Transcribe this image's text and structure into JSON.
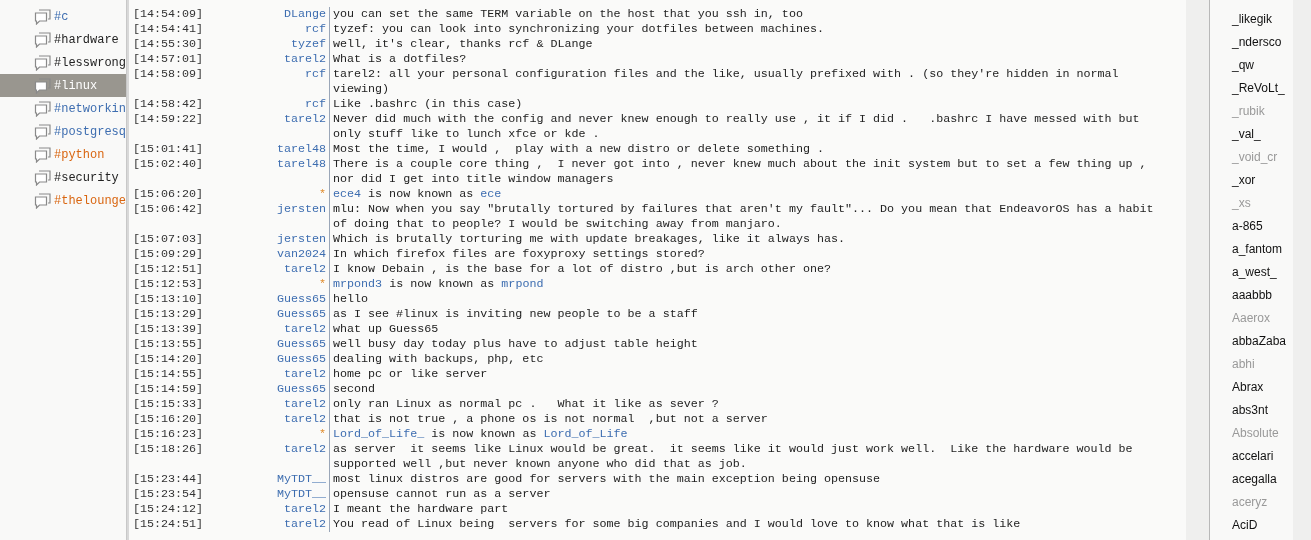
{
  "channels": [
    {
      "name": "#c",
      "color": "#3d6db0",
      "selected": false
    },
    {
      "name": "#hardware",
      "color": "#222222",
      "selected": false
    },
    {
      "name": "#lesswrong",
      "color": "#222222",
      "selected": false
    },
    {
      "name": "#linux",
      "selected": true
    },
    {
      "name": "#networkin",
      "color": "#3d6db0",
      "selected": false
    },
    {
      "name": "#postgresq",
      "color": "#3d6db0",
      "selected": false
    },
    {
      "name": "#python",
      "color": "#d9650f",
      "selected": false
    },
    {
      "name": "#security",
      "color": "#222222",
      "selected": false
    },
    {
      "name": "#thelounge",
      "color": "#d9650f",
      "selected": false
    }
  ],
  "messages": [
    {
      "kind": "message",
      "time": "[14:54:09]",
      "nick": "DLange",
      "text": "you can set the same TERM variable on the host that you ssh in, too"
    },
    {
      "kind": "message",
      "time": "[14:54:41]",
      "nick": "rcf",
      "text": "tyzef: you can look into synchronizing your dotfiles between machines."
    },
    {
      "kind": "message",
      "time": "[14:55:30]",
      "nick": "tyzef",
      "text": "well, it's clear, thanks rcf & DLange"
    },
    {
      "kind": "message",
      "time": "[14:57:01]",
      "nick": "tarel2",
      "text": "What is a dotfiles?"
    },
    {
      "kind": "message",
      "time": "[14:58:09]",
      "nick": "rcf",
      "text": "tarel2: all your personal configuration files and the like, usually prefixed with . (so they're hidden in normal viewing)"
    },
    {
      "kind": "message",
      "time": "[14:58:42]",
      "nick": "rcf",
      "text": "Like .bashrc (in this case)"
    },
    {
      "kind": "message",
      "time": "[14:59:22]",
      "nick": "tarel2",
      "text": "Never did much with the config and never knew enough to really use , it if I did .   .bashrc I have messed with but only stuff like to lunch xfce or kde ."
    },
    {
      "kind": "message",
      "time": "[15:01:41]",
      "nick": "tarel48",
      "text": "Most the time, I would ,  play with a new distro or delete something ."
    },
    {
      "kind": "message",
      "time": "[15:02:40]",
      "nick": "tarel48",
      "text": "There is a couple core thing ,  I never got into , never knew much about the init system but to set a few thing up , nor did I get into title window managers"
    },
    {
      "kind": "nick_change",
      "time": "[15:06:20]",
      "nick": "*",
      "old": "ece4",
      "text": "is now known as",
      "new": "ece"
    },
    {
      "kind": "message",
      "time": "[15:06:42]",
      "nick": "jersten",
      "text": "mlu: Now when you say \"brutally tortured by failures that aren't my fault\"... Do you mean that EndeavorOS has a habit of doing that to people? I would be switching away from manjaro."
    },
    {
      "kind": "message",
      "time": "[15:07:03]",
      "nick": "jersten",
      "text": "Which is brutally torturing me with update breakages, like it always has."
    },
    {
      "kind": "message",
      "time": "[15:09:29]",
      "nick": "van2024",
      "text": "In which firefox files are foxyproxy settings stored?"
    },
    {
      "kind": "message",
      "time": "[15:12:51]",
      "nick": "tarel2",
      "text": "I know Debain , is the base for a lot of distro ,but is arch other one?"
    },
    {
      "kind": "nick_change",
      "time": "[15:12:53]",
      "nick": "*",
      "old": "mrpond3",
      "text": "is now known as",
      "new": "mrpond"
    },
    {
      "kind": "message",
      "time": "[15:13:10]",
      "nick": "Guess65",
      "text": "hello"
    },
    {
      "kind": "message",
      "time": "[15:13:29]",
      "nick": "Guess65",
      "text": "as I see #linux is inviting new people to be a staff"
    },
    {
      "kind": "message",
      "time": "[15:13:39]",
      "nick": "tarel2",
      "text": "what up Guess65"
    },
    {
      "kind": "message",
      "time": "[15:13:55]",
      "nick": "Guess65",
      "text": "well busy day today plus have to adjust table height"
    },
    {
      "kind": "message",
      "time": "[15:14:20]",
      "nick": "Guess65",
      "text": "dealing with backups, php, etc"
    },
    {
      "kind": "message",
      "time": "[15:14:55]",
      "nick": "tarel2",
      "text": "home pc or like server"
    },
    {
      "kind": "message",
      "time": "[15:14:59]",
      "nick": "Guess65",
      "text": "second"
    },
    {
      "kind": "message",
      "time": "[15:15:33]",
      "nick": "tarel2",
      "text": "only ran Linux as normal pc .   What it like as sever ?"
    },
    {
      "kind": "message",
      "time": "[15:16:20]",
      "nick": "tarel2",
      "text": "that is not true , a phone os is not normal  ,but not a server"
    },
    {
      "kind": "nick_change",
      "time": "[15:16:23]",
      "nick": "*",
      "old": "Lord_of_Life_",
      "text": "is now known as",
      "new": "Lord_of_Life"
    },
    {
      "kind": "message",
      "time": "[15:18:26]",
      "nick": "tarel2",
      "text": "as server  it seems like Linux would be great.  it seems like it would just work well.  Like the hardware would be supported well ,but never known anyone who did that as job."
    },
    {
      "kind": "message",
      "time": "[15:23:44]",
      "nick": "MyTDT__",
      "text": "most linux distros are good for servers with the main exception being opensuse"
    },
    {
      "kind": "message",
      "time": "[15:23:54]",
      "nick": "MyTDT__",
      "text": "opensuse cannot run as a server"
    },
    {
      "kind": "message",
      "time": "[15:24:12]",
      "nick": "tarel2",
      "text": "I meant the hardware part"
    },
    {
      "kind": "message",
      "time": "[15:24:51]",
      "nick": "tarel2",
      "text": "You read of Linux being  servers for some big companies and I would love to know what that is like"
    }
  ],
  "users": [
    {
      "name": "_likegik",
      "away": false
    },
    {
      "name": "_ndersco",
      "away": false
    },
    {
      "name": "_qw",
      "away": false
    },
    {
      "name": "_ReVoLt_",
      "away": false
    },
    {
      "name": "_rubik",
      "away": true
    },
    {
      "name": "_val_",
      "away": false
    },
    {
      "name": "_void_cr",
      "away": true
    },
    {
      "name": "_xor",
      "away": false
    },
    {
      "name": "_xs",
      "away": true
    },
    {
      "name": "a-865",
      "away": false
    },
    {
      "name": "a_fantom",
      "away": false
    },
    {
      "name": "a_west_",
      "away": false
    },
    {
      "name": "aaabbb",
      "away": false
    },
    {
      "name": "Aaerox",
      "away": true
    },
    {
      "name": "abbaZaba",
      "away": false
    },
    {
      "name": "abhi",
      "away": true
    },
    {
      "name": "Abrax",
      "away": false
    },
    {
      "name": "abs3nt",
      "away": false
    },
    {
      "name": "Absolute",
      "away": true
    },
    {
      "name": "accelari",
      "away": false
    },
    {
      "name": "acegalla",
      "away": false
    },
    {
      "name": "aceryz",
      "away": true
    },
    {
      "name": "AciD",
      "away": false
    }
  ]
}
